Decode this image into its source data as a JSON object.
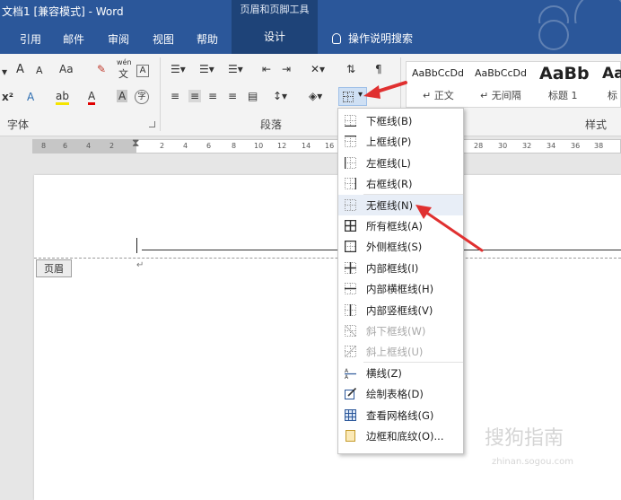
{
  "titlebar": {
    "doc_title": "文档1 [兼容模式]  -  Word",
    "context_title": "页眉和页脚工具"
  },
  "tabs": {
    "items": [
      "引用",
      "邮件",
      "审阅",
      "视图",
      "帮助"
    ],
    "context_tab": "设计",
    "tell_me": "操作说明搜索"
  },
  "ribbon": {
    "font_group": {
      "label": "字体",
      "grow_font": "A",
      "shrink_font": "A",
      "change_case": "Aa",
      "phonetic": "wén",
      "phonetic_char": "文",
      "char_border": "A",
      "superscript": "x²",
      "text_effects": "A",
      "highlight": "ab",
      "font_color": "A",
      "char_shading": "A",
      "enclose": "字"
    },
    "paragraph_group": {
      "label": "段落"
    },
    "styles_group": {
      "label": "样式",
      "tiles": [
        {
          "sample": "AaBbCcDd",
          "name": "↵ 正文"
        },
        {
          "sample": "AaBbCcDd",
          "name": "↵ 无间隔"
        },
        {
          "sample": "AaBb",
          "name": "标题 1"
        },
        {
          "sample": "Aa",
          "name": "标"
        }
      ]
    }
  },
  "ruler": {
    "left_numbers": [
      "8",
      "6",
      "4",
      "2"
    ],
    "right_numbers": [
      "2",
      "4",
      "6",
      "8",
      "10",
      "12",
      "14",
      "16",
      "28",
      "30",
      "32",
      "34",
      "36",
      "38"
    ]
  },
  "document": {
    "header_tag": "页眉",
    "paragraph_mark": "↵"
  },
  "borders_menu": {
    "items": [
      {
        "label": "下框线(B)",
        "icon": "bottom-border-icon",
        "disabled": false
      },
      {
        "label": "上框线(P)",
        "icon": "top-border-icon",
        "disabled": false
      },
      {
        "label": "左框线(L)",
        "icon": "left-border-icon",
        "disabled": false
      },
      {
        "label": "右框线(R)",
        "icon": "right-border-icon",
        "disabled": false
      },
      {
        "label": "无框线(N)",
        "icon": "no-border-icon",
        "disabled": false
      },
      {
        "label": "所有框线(A)",
        "icon": "all-borders-icon",
        "disabled": false
      },
      {
        "label": "外侧框线(S)",
        "icon": "outside-borders-icon",
        "disabled": false
      },
      {
        "label": "内部框线(I)",
        "icon": "inside-borders-icon",
        "disabled": false
      },
      {
        "label": "内部横框线(H)",
        "icon": "inside-horizontal-border-icon",
        "disabled": false
      },
      {
        "label": "内部竖框线(V)",
        "icon": "inside-vertical-border-icon",
        "disabled": false
      },
      {
        "label": "斜下框线(W)",
        "icon": "diagonal-down-border-icon",
        "disabled": true
      },
      {
        "label": "斜上框线(U)",
        "icon": "diagonal-up-border-icon",
        "disabled": true
      },
      {
        "label": "横线(Z)",
        "icon": "horizontal-line-icon",
        "disabled": false
      },
      {
        "label": "绘制表格(D)",
        "icon": "draw-table-icon",
        "disabled": false
      },
      {
        "label": "查看网格线(G)",
        "icon": "view-gridlines-icon",
        "disabled": false
      },
      {
        "label": "边框和底纹(O)...",
        "icon": "borders-shading-icon",
        "disabled": false
      }
    ]
  },
  "watermark": {
    "text": "搜狗指南",
    "url": "zhinan.sogou.com"
  },
  "colors": {
    "title_blue": "#2b579a",
    "context_blue": "#1e4378",
    "annotation_red": "#e03030"
  }
}
